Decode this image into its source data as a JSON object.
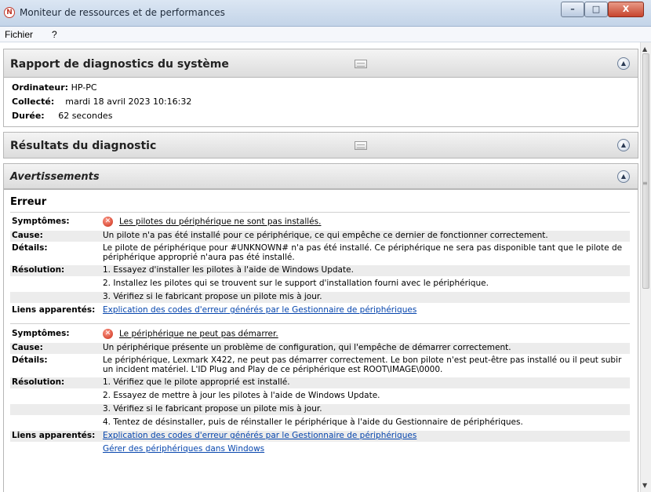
{
  "window": {
    "title": "Moniteur de ressources et de performances",
    "minimize_glyph": "–",
    "maximize_glyph": "□",
    "close_glyph": "X"
  },
  "menu": {
    "file": "Fichier",
    "help": "?"
  },
  "report": {
    "header": "Rapport de diagnostics du système",
    "computer_label": "Ordinateur:",
    "computer_value": "HP-PC",
    "collected_label": "Collecté:",
    "collected_value": "mardi 18 avril 2023 10:16:32",
    "duration_label": "Durée:",
    "duration_value": "62 secondes"
  },
  "results": {
    "header": "Résultats du diagnostic"
  },
  "warnings": {
    "header": "Avertissements"
  },
  "error": {
    "title": "Erreur",
    "items": [
      {
        "symptoms_label": "Symptômes:",
        "symptoms": "Les pilotes du périphérique ne sont pas installés.",
        "cause_label": "Cause:",
        "cause": "Un pilote n'a pas été installé pour ce périphérique, ce qui empêche ce dernier de fonctionner correctement.",
        "details_label": "Détails:",
        "details": "Le pilote de périphérique pour #UNKNOWN# n'a pas été installé. Ce périphérique ne sera pas disponible tant que le pilote de périphérique approprié n'aura pas été installé.",
        "resolution_label": "Résolution:",
        "resolution": [
          "1. Essayez d'installer les pilotes à l'aide de Windows Update.",
          "2. Installez les pilotes qui se trouvent sur le support d'installation fourni avec le périphérique.",
          "3. Vérifiez si le fabricant propose un pilote mis à jour."
        ],
        "links_label": "Liens apparentés:",
        "links": [
          "Explication des codes d'erreur générés par le Gestionnaire de périphériques"
        ]
      },
      {
        "symptoms_label": "Symptômes:",
        "symptoms": "Le périphérique ne peut pas démarrer.",
        "cause_label": "Cause:",
        "cause": "Un périphérique présente un problème de configuration, qui l'empêche de démarrer correctement.",
        "details_label": "Détails:",
        "details": "Le périphérique, Lexmark X422, ne peut pas démarrer correctement. Le bon pilote n'est peut-être pas installé ou il peut subir un incident matériel. L'ID Plug and Play de ce périphérique est ROOT\\IMAGE\\0000.",
        "resolution_label": "Résolution:",
        "resolution": [
          "1. Vérifiez que le pilote approprié est installé.",
          "2. Essayez de mettre à jour les pilotes à l'aide de Windows Update.",
          "3. Vérifiez si le fabricant propose un pilote mis à jour.",
          "4. Tentez de désinstaller, puis de réinstaller le périphérique à l'aide du Gestionnaire de périphériques."
        ],
        "links_label": "Liens apparentés:",
        "links": [
          "Explication des codes d'erreur générés par le Gestionnaire de périphériques",
          "Gérer des périphériques dans Windows"
        ]
      }
    ]
  },
  "icons": {
    "error": "error-x-icon",
    "collapse": "chevron-up-circle-icon",
    "section": "table-view-icon"
  }
}
